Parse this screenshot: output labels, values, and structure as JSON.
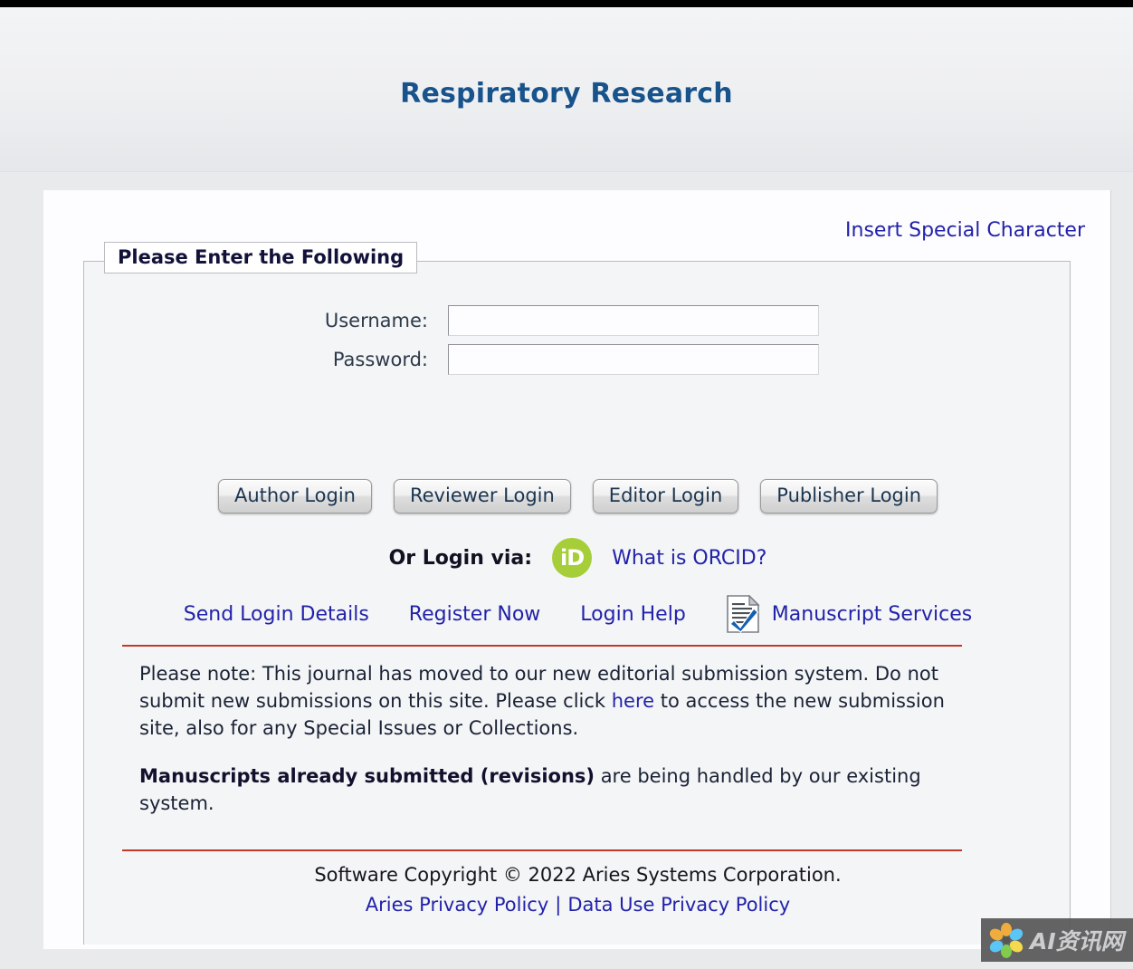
{
  "window": {
    "top_bar_color": "#000000",
    "background_color": "#e9eaec"
  },
  "banner": {
    "journal_title": "Respiratory Research",
    "title_color": "#18538c"
  },
  "toolbar": {
    "insert_special_character_label": "Insert Special Character"
  },
  "login_form": {
    "legend": "Please Enter the Following",
    "fields": [
      {
        "label": "Username:",
        "value": "",
        "placeholder": "",
        "name": "username"
      },
      {
        "label": "Password:",
        "value": "",
        "placeholder": "",
        "name": "password"
      }
    ],
    "buttons": [
      {
        "label": "Author Login"
      },
      {
        "label": "Reviewer Login"
      },
      {
        "label": "Editor Login"
      },
      {
        "label": "Publisher Login"
      }
    ]
  },
  "orcid": {
    "prompt": "Or Login via:",
    "badge_text": "iD",
    "badge_color": "#a6ce39",
    "help_link": "What is ORCID?"
  },
  "helper_links": {
    "send_login_details": "Send Login Details",
    "register_now": "Register Now",
    "login_help": "Login Help",
    "manuscript_services": "Manuscript Services"
  },
  "notice": {
    "rule_color": "#c0392b",
    "paragraph1_part1": "Please note: This journal has moved to our new editorial submission system. Do not submit new submissions on this site. Please click ",
    "paragraph1_link": "here",
    "paragraph1_part2": " to access the new submission site, also for any Special Issues or Collections.",
    "paragraph2_bold": "Manuscripts already submitted (revisions)",
    "paragraph2_rest": " are being handled by our existing system."
  },
  "footer": {
    "copyright": "Software Copyright © 2022 Aries Systems Corporation.",
    "aries_privacy_policy": "Aries Privacy Policy",
    "separator": "|",
    "data_use_privacy_policy": "Data Use Privacy Policy"
  },
  "watermark": {
    "text": "AI资讯网"
  },
  "link_color": "#2222aa"
}
